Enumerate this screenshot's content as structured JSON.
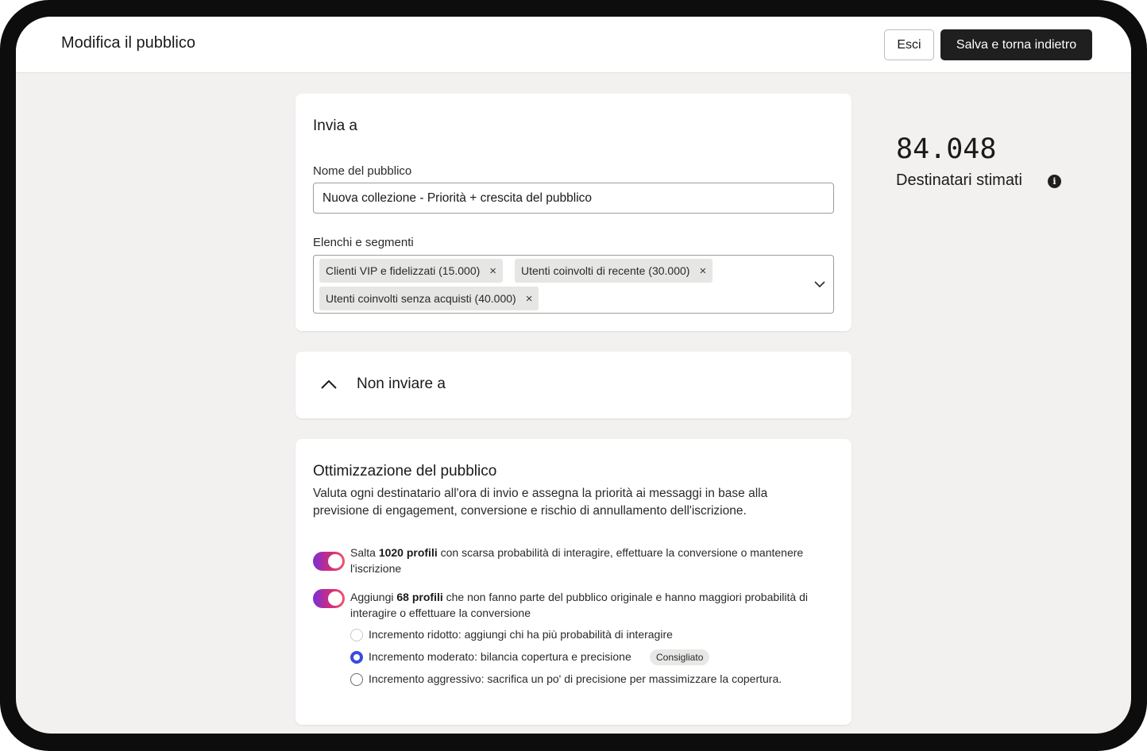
{
  "header": {
    "title": "Modifica il pubblico",
    "exit_label": "Esci",
    "save_label": "Salva e torna indietro"
  },
  "send_to": {
    "title": "Invia a",
    "audience_name_label": "Nome del pubblico",
    "audience_name_value": "Nuova collezione - Priorità + crescita del pubblico",
    "lists_label": "Elenchi e segmenti",
    "chips": [
      {
        "label": "Clienti VIP e fidelizzati (15.000)"
      },
      {
        "label": "Utenti coinvolti di recente (30.000)"
      },
      {
        "label": "Utenti coinvolti senza acquisti (40.000)"
      }
    ],
    "remove_glyph": "×"
  },
  "exclude": {
    "title": "Non inviare a"
  },
  "optimization": {
    "title": "Ottimizzazione del pubblico",
    "description": "Valuta ogni destinatario all'ora di invio e assegna la priorità ai messaggi in base alla previsione di engagement, conversione e rischio di annullamento dell'iscrizione.",
    "skip": {
      "enabled": true,
      "prefix": "Salta ",
      "bold": "1020 profili",
      "suffix": " con scarsa probabilità di interagire, effettuare la conversione o mantenere l'iscrizione"
    },
    "add": {
      "enabled": true,
      "prefix": "Aggiungi ",
      "bold": "68 profili",
      "suffix": " che non fanno parte del pubblico originale e hanno maggiori probabilità di interagire o effettuare la conversione"
    },
    "levels": [
      {
        "label": "Incremento ridotto: aggiungi chi ha più probabilità di interagire",
        "selected": false
      },
      {
        "label": "Incremento moderato: bilancia copertura e precisione",
        "selected": true
      },
      {
        "label": "Incremento aggressivo: sacrifica un po' di precisione per massimizzare la copertura.",
        "selected": false
      }
    ],
    "recommended_badge": "Consigliato"
  },
  "estimate": {
    "value": "84.048",
    "label": "Destinatari stimati",
    "info_glyph": "i"
  },
  "colors": {
    "primary_button": "#1f1f1f",
    "radio_selected": "#3a4bdf",
    "toggle_gradient_start": "#7b2fd6",
    "toggle_gradient_end": "#f2546c",
    "background": "#f2f1ef"
  },
  "icons": {
    "dropdown": "chevron-down-icon",
    "collapse": "chevron-up-icon",
    "info": "info-icon",
    "remove": "close-icon"
  }
}
